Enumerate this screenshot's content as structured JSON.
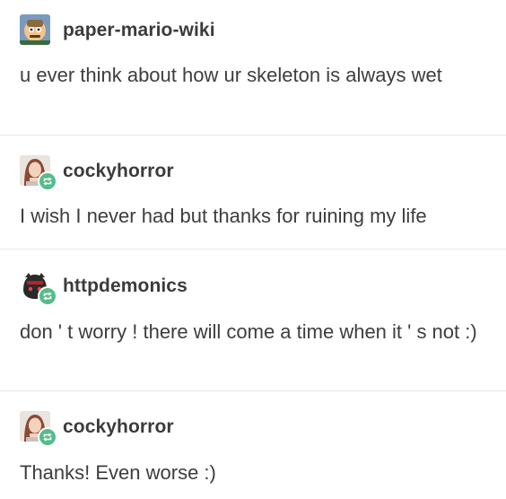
{
  "thread": [
    {
      "username": "paper-mario-wiki",
      "avatar_icon": "paper-mario-avatar",
      "reblogged": false,
      "text": "u ever think about how ur skeleton is always wet"
    },
    {
      "username": "cockyhorror",
      "avatar_icon": "user-photo-avatar",
      "reblogged": true,
      "text": "I wish I never had but thanks for ruining my life"
    },
    {
      "username": "httpdemonics",
      "avatar_icon": "dark-character-avatar",
      "reblogged": true,
      "text": "don ' t worry ! there will come a time when it ' s not :)"
    },
    {
      "username": "cockyhorror",
      "avatar_icon": "user-photo-avatar",
      "reblogged": true,
      "text": "Thanks! Even worse :)"
    }
  ],
  "colors": {
    "reblog_badge": "#56bc8a",
    "separator": "#e8e8e8",
    "text": "#3d3d3d"
  }
}
